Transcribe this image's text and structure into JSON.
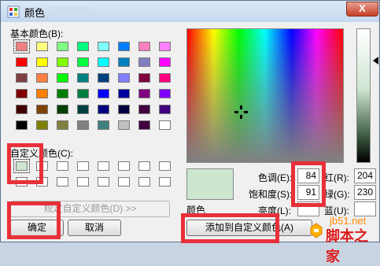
{
  "window": {
    "title": "颜色",
    "close_label": "X"
  },
  "basic_colors": {
    "label": "基本颜色(B):",
    "swatches": [
      [
        "#f08080",
        "#ffff80",
        "#80ff80",
        "#00ff80",
        "#80ffff",
        "#0080ff",
        "#ff80c0",
        "#ff80ff"
      ],
      [
        "#ff0000",
        "#ffff00",
        "#80ff00",
        "#00ff40",
        "#00ffff",
        "#0080c0",
        "#8080c0",
        "#ff00ff"
      ],
      [
        "#804040",
        "#ff8040",
        "#00ff00",
        "#008080",
        "#004080",
        "#8080ff",
        "#800040",
        "#ff0080"
      ],
      [
        "#800000",
        "#ff8000",
        "#008000",
        "#008040",
        "#0000ff",
        "#0000a0",
        "#800080",
        "#8000ff"
      ],
      [
        "#400000",
        "#804000",
        "#004000",
        "#004040",
        "#000080",
        "#000040",
        "#400040",
        "#400080"
      ],
      [
        "#000000",
        "#808000",
        "#808040",
        "#808080",
        "#408080",
        "#c0c0c0",
        "#400040",
        "#ffffff"
      ]
    ]
  },
  "custom_colors": {
    "label": "自定义颜色(C):",
    "swatches": [
      [
        "#cce6d0",
        "#ffffff",
        "#ffffff",
        "#ffffff",
        "#ffffff",
        "#ffffff",
        "#ffffff",
        "#ffffff"
      ],
      [
        "#ffffff",
        "#ffffff",
        "#ffffff",
        "#ffffff",
        "#ffffff",
        "#ffffff",
        "#ffffff",
        "#ffffff"
      ]
    ]
  },
  "buttons": {
    "define_custom": "规定自定义颜色(D) >>",
    "ok": "确定",
    "cancel": "取消",
    "add_custom": "添加到自定义颜色(A)"
  },
  "color_info": {
    "preview_label": "颜色",
    "hue_label": "色调(E):",
    "hue_value": "84",
    "sat_label": "饱和度(S):",
    "sat_value": "91",
    "lum_label": "亮度(L):",
    "lum_value": "",
    "red_label": "红(R):",
    "red_value": "204",
    "green_label": "绿(G):",
    "green_value": "230",
    "blue_label": "蓝(U):",
    "blue_value": ""
  },
  "watermark": {
    "site": "jb51.net",
    "name": "脚本之家"
  },
  "colors": {
    "highlight": "#e8303a",
    "selected_color": "#cce6d0"
  }
}
